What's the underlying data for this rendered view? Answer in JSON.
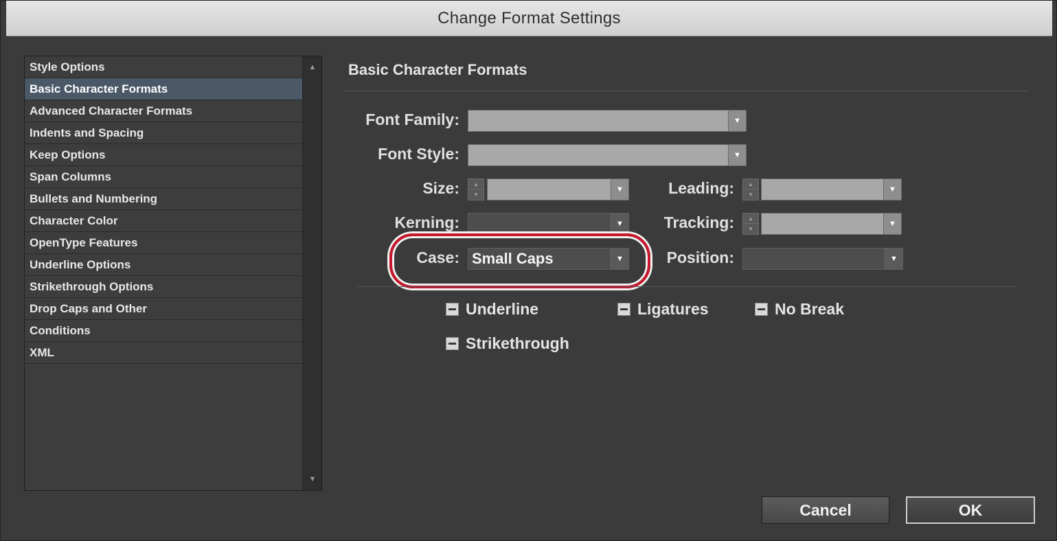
{
  "window": {
    "title": "Change Format Settings"
  },
  "categories": [
    {
      "label": "Style Options"
    },
    {
      "label": "Basic Character Formats",
      "selected": true
    },
    {
      "label": "Advanced Character Formats"
    },
    {
      "label": "Indents and Spacing"
    },
    {
      "label": "Keep Options"
    },
    {
      "label": "Span Columns"
    },
    {
      "label": "Bullets and Numbering"
    },
    {
      "label": "Character Color"
    },
    {
      "label": "OpenType Features"
    },
    {
      "label": "Underline Options"
    },
    {
      "label": "Strikethrough Options"
    },
    {
      "label": "Drop Caps and Other"
    },
    {
      "label": "Conditions"
    },
    {
      "label": "XML"
    }
  ],
  "panel": {
    "title": "Basic Character Formats",
    "font_family": {
      "label": "Font Family:",
      "value": ""
    },
    "font_style": {
      "label": "Font Style:",
      "value": ""
    },
    "size": {
      "label": "Size:",
      "value": ""
    },
    "leading": {
      "label": "Leading:",
      "value": ""
    },
    "kerning": {
      "label": "Kerning:",
      "value": ""
    },
    "tracking": {
      "label": "Tracking:",
      "value": ""
    },
    "case": {
      "label": "Case:",
      "value": "Small Caps"
    },
    "position": {
      "label": "Position:",
      "value": ""
    },
    "checkboxes": {
      "underline": "Underline",
      "ligatures": "Ligatures",
      "no_break": "No Break",
      "strikethrough": "Strikethrough"
    },
    "checkbox_state": "indeterminate"
  },
  "buttons": {
    "cancel": "Cancel",
    "ok": "OK"
  },
  "colors": {
    "highlight": "#c8172c",
    "selected_row": "#4a5868"
  }
}
